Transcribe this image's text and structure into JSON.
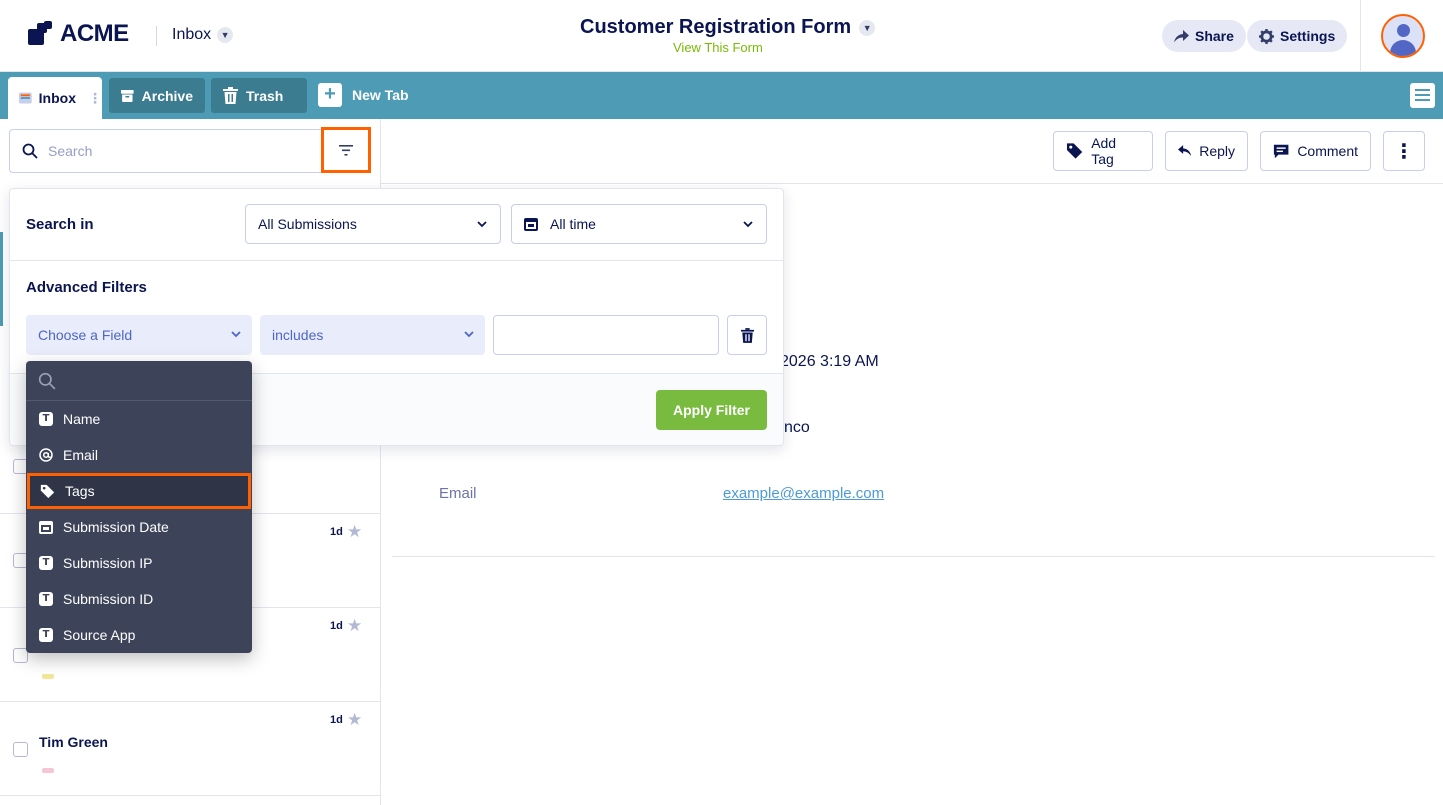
{
  "header": {
    "logo_text": "ACME",
    "inbox_label": "Inbox",
    "form_title": "Customer Registration Form",
    "view_form_link": "View This Form",
    "share_label": "Share",
    "settings_label": "Settings"
  },
  "tabs": {
    "inbox": "Inbox",
    "archive": "Archive",
    "trash": "Trash",
    "new_tab": "New Tab"
  },
  "search": {
    "placeholder": "Search"
  },
  "toolbar": {
    "add_tag": "Add Tag",
    "reply": "Reply",
    "comment": "Comment"
  },
  "filter_panel": {
    "search_in_label": "Search in",
    "submissions_select": "All Submissions",
    "time_select": "All time",
    "advanced_label": "Advanced Filters",
    "field_select": "Choose a Field",
    "operator_select": "includes",
    "value": "",
    "apply_label": "Apply Filter"
  },
  "field_dropdown": {
    "search_value": "",
    "items": [
      {
        "label": "Name",
        "icon": "text-icon"
      },
      {
        "label": "Email",
        "icon": "at-icon"
      },
      {
        "label": "Tags",
        "icon": "tag-icon"
      },
      {
        "label": "Submission Date",
        "icon": "calendar-icon"
      },
      {
        "label": "Submission IP",
        "icon": "text-icon"
      },
      {
        "label": "Submission ID",
        "icon": "text-icon"
      },
      {
        "label": "Source App",
        "icon": "text-icon"
      }
    ]
  },
  "submissions": [
    {
      "age": "1d",
      "name": "",
      "tag_color": "#f1e69a"
    },
    {
      "age": "1d",
      "name": "",
      "tag_color": "#f1e69a"
    },
    {
      "age": "1d",
      "name": "Tim Green",
      "tag_color": "#f5c7d3"
    }
  ],
  "detail": {
    "date_fragment": "2026 3:19 AM",
    "name_fragment": "nco",
    "email_label": "Email",
    "email_value": "example@example.com"
  },
  "colors": {
    "brand_navy": "#0a1551",
    "tab_bar": "#4d9bb5",
    "highlight": "#ff6100",
    "apply_green": "#78bb3e"
  }
}
